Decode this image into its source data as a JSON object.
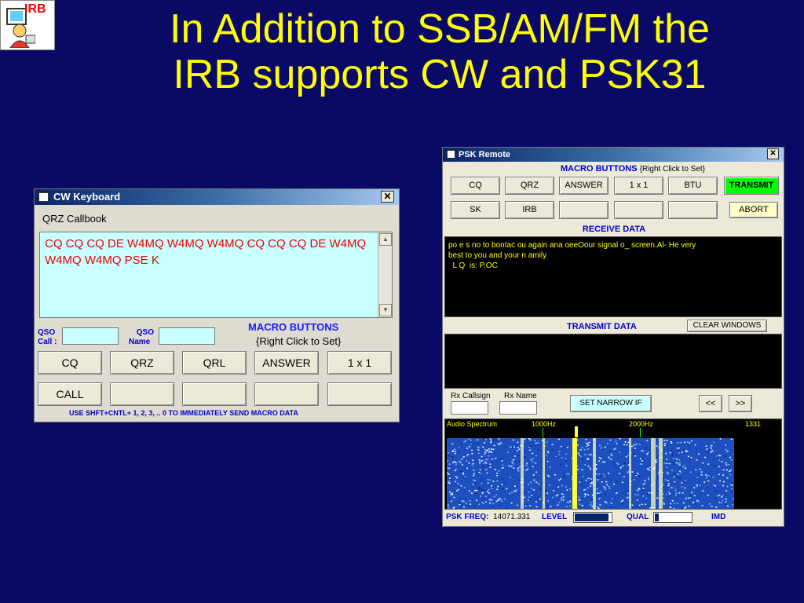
{
  "logo": {
    "text": "IRB"
  },
  "slide": {
    "title_line1": "In Addition to SSB/AM/FM the",
    "title_line2": "IRB supports CW and PSK31"
  },
  "cw_keyboard": {
    "title": "CW Keyboard",
    "close": "✕",
    "menu": "QRZ Callbook",
    "transmit_text": "CQ CQ CQ DE W4MQ W4MQ W4MQ CQ CQ CQ DE W4MQ W4MQ W4MQ  PSE K",
    "qso_call_label_1": "QSO",
    "qso_call_label_2": "Call :",
    "qso_name_label_1": "QSO",
    "qso_name_label_2": "Name",
    "macro_title": "MACRO BUTTONS",
    "macro_subtitle": "{Right Click to Set}",
    "buttons_row1": [
      "CQ",
      "QRZ",
      "QRL",
      "ANSWER",
      "1 x 1"
    ],
    "buttons_row2": [
      "CALL",
      "",
      "",
      "",
      ""
    ],
    "hint": "USE SHFT+CNTL+ 1, 2, 3, .. 0 TO IMMEDIATELY SEND MACRO DATA"
  },
  "psk_remote": {
    "title": "PSK Remote",
    "close": "✕",
    "macro_title": "MACRO BUTTONS",
    "macro_subtitle": "{Right Click to Set}",
    "buttons_row1": [
      "CQ",
      "QRZ",
      "ANSWER",
      "1 x 1",
      "BTU"
    ],
    "buttons_row2": [
      "SK",
      "IRB",
      "",
      "",
      ""
    ],
    "transmit": "TRANSMIT",
    "abort": "ABORT",
    "receive_label": "RECEIVE DATA",
    "receive_text_1": "po e s no  to bontac  ou again ana  oeeOour signal o_ screen.Al- He very",
    "receive_text_2": "best to you and your n amily",
    "receive_text_3": "  L Q  is: P.OC",
    "transmit_label": "TRANSMIT DATA",
    "clear_windows": "CLEAR WINDOWS",
    "rx_callsign": "Rx Callsign",
    "rx_name": "Rx Name",
    "set_narrow": "SET NARROW IF",
    "prev": "<<",
    "next": ">>",
    "spectrum_label": "Audio Spectrum",
    "tick_1000": "1000Hz",
    "tick_2000": "2000Hz",
    "tick_value": "1331",
    "psk_freq_label": "PSK FREQ:",
    "psk_freq_value": "14071.331",
    "level_label": "LEVEL",
    "level_fill": 0.9,
    "qual_label": "QUAL",
    "qual_fill": 0.1,
    "imd_label": "IMD"
  }
}
